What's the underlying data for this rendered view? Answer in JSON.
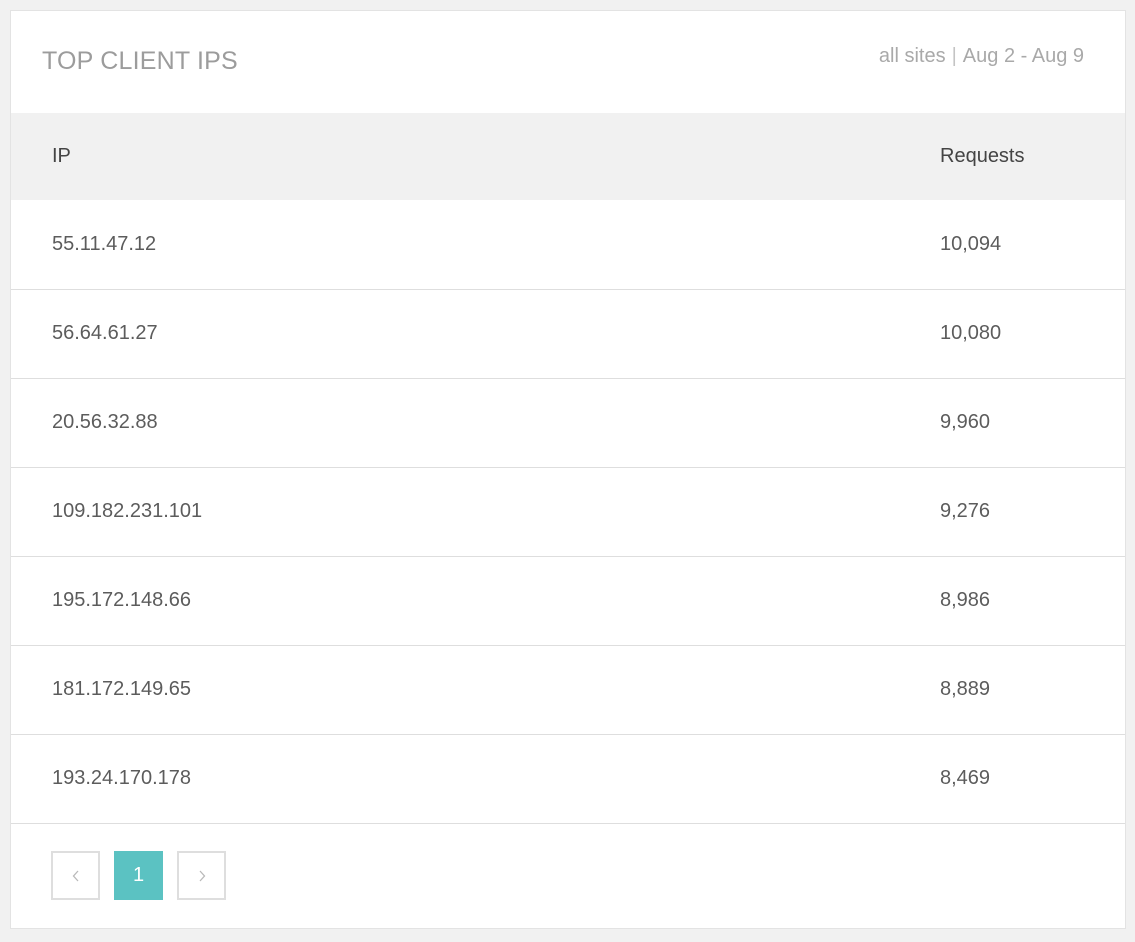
{
  "widget": {
    "title": "TOP CLIENT IPS",
    "scope": "all sites",
    "separator": "|",
    "date_range": "Aug 2 - Aug 9"
  },
  "table": {
    "columns": [
      "IP",
      "Requests"
    ],
    "rows": [
      {
        "ip": "55.11.47.12",
        "requests": "10,094"
      },
      {
        "ip": "56.64.61.27",
        "requests": "10,080"
      },
      {
        "ip": "20.56.32.88",
        "requests": "9,960"
      },
      {
        "ip": "109.182.231.101",
        "requests": "9,276"
      },
      {
        "ip": "195.172.148.66",
        "requests": "8,986"
      },
      {
        "ip": "181.172.149.65",
        "requests": "8,889"
      },
      {
        "ip": "193.24.170.178",
        "requests": "8,469"
      }
    ]
  },
  "pagination": {
    "prev_icon": "chevron-left-icon",
    "current_page": "1",
    "next_icon": "chevron-right-icon",
    "active_color": "#5bc2c2"
  }
}
